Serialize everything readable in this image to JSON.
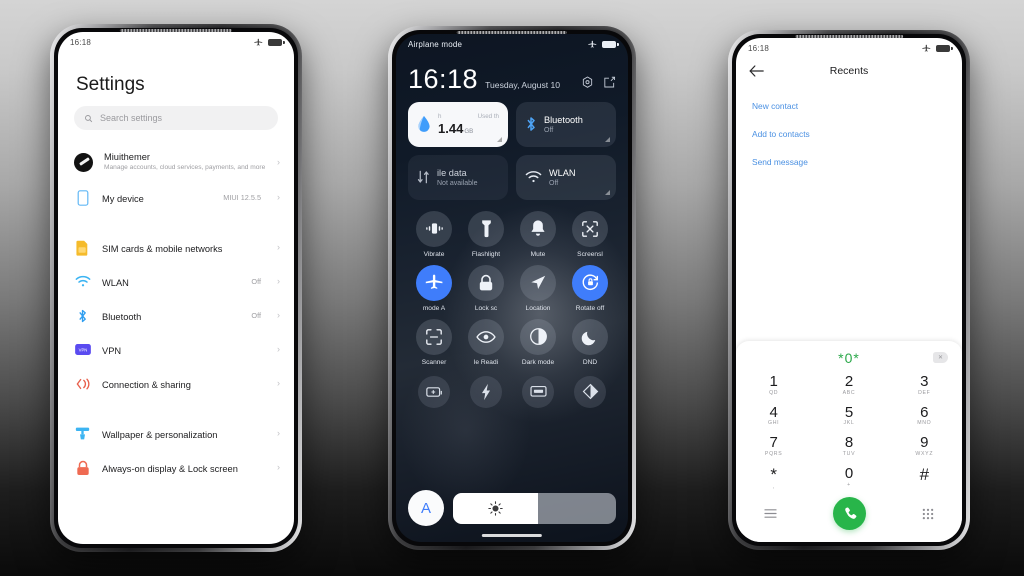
{
  "background": {
    "top_color": "#d4d4d4",
    "bottom_color": "#0a0a0a"
  },
  "phone_settings": {
    "status": {
      "time": "16:18",
      "airplane_icon": "airplane-icon",
      "battery_icon": "battery-icon"
    },
    "title": "Settings",
    "search": {
      "placeholder": "Search settings",
      "icon": "search-icon"
    },
    "account": {
      "name": "Miuithemer",
      "subtitle": "Manage accounts, cloud services, payments, and more",
      "avatar": "user-avatar"
    },
    "items": [
      {
        "label": "My device",
        "value": "MIUI 12.5.5",
        "icon": "phone-icon",
        "color": "#62b8f5",
        "gap_after": true
      },
      {
        "label": "SIM cards & mobile networks",
        "value": "",
        "icon": "sim-card-icon",
        "color": "#f5bb2b"
      },
      {
        "label": "WLAN",
        "value": "Off",
        "icon": "wifi-icon",
        "color": "#3cb4f2"
      },
      {
        "label": "Bluetooth",
        "value": "Off",
        "icon": "bluetooth-icon",
        "color": "#2f9ef0"
      },
      {
        "label": "VPN",
        "value": "",
        "icon": "vpn-icon",
        "color": "#5a4bf0"
      },
      {
        "label": "Connection & sharing",
        "value": "",
        "icon": "connection-sharing-icon",
        "color": "#e8604c",
        "gap_after": true
      },
      {
        "label": "Wallpaper & personalization",
        "value": "",
        "icon": "wallpaper-icon",
        "color": "#3cb4f2"
      },
      {
        "label": "Always-on display & Lock screen",
        "value": "",
        "icon": "lock-icon",
        "color": "#ef6a52"
      }
    ],
    "chevron": "›"
  },
  "phone_control_center": {
    "status": {
      "time": "",
      "label": "Airplane mode",
      "airplane_icon": "airplane-icon",
      "battery_icon": "battery-icon"
    },
    "clock": {
      "time": "16:18",
      "date": "Tuesday, August 10"
    },
    "actions": [
      {
        "name": "settings-gear-icon"
      },
      {
        "name": "edit-icon"
      }
    ],
    "big_tiles": [
      {
        "name": "data-usage-tile",
        "style": "white",
        "icon": "data-drop-icon",
        "head_left": "h",
        "head_right": "Used th",
        "value": "1.44",
        "unit": "GB"
      },
      {
        "name": "bluetooth-tile",
        "style": "dark",
        "icon": "bluetooth-icon",
        "title": "Bluetooth",
        "sub": "Off"
      },
      {
        "name": "mobile-data-tile",
        "style": "dim",
        "icon": "mobile-data-icon",
        "title": "ile data",
        "sub": "Not available"
      },
      {
        "name": "wlan-tile",
        "style": "dark",
        "icon": "wifi-icon",
        "title": "WLAN",
        "sub": "Off"
      }
    ],
    "toggles": [
      {
        "label": "Vibrate",
        "icon": "vibrate-icon",
        "on": false
      },
      {
        "label": "Flashlight",
        "icon": "flashlight-icon",
        "on": false
      },
      {
        "label": "Mute",
        "icon": "bell-icon",
        "on": false
      },
      {
        "label": "Screensl",
        "icon": "screenshot-icon",
        "on": false
      },
      {
        "label": "mode    A",
        "icon": "airplane-icon",
        "on": true
      },
      {
        "label": "Lock sc",
        "icon": "lock-icon",
        "on": false
      },
      {
        "label": "Location",
        "icon": "location-icon",
        "on": false
      },
      {
        "label": "Rotate off",
        "icon": "rotate-lock-icon",
        "on": true
      },
      {
        "label": "Scanner",
        "icon": "scan-icon",
        "on": false
      },
      {
        "label": "le    Readi",
        "icon": "eye-icon",
        "on": false
      },
      {
        "label": "Dark mode",
        "icon": "contrast-icon",
        "on": false
      },
      {
        "label": "DND",
        "icon": "moon-icon",
        "on": false
      }
    ],
    "mini_toggles": [
      {
        "icon": "battery-saver-icon"
      },
      {
        "icon": "lightning-icon"
      },
      {
        "icon": "cast-screen-icon"
      },
      {
        "icon": "theme-contrast-icon"
      }
    ],
    "brightness": {
      "auto_label": "A",
      "icon": "brightness-icon",
      "percent": 52
    }
  },
  "phone_dialer": {
    "status": {
      "time": "16:18",
      "airplane_icon": "airplane-icon",
      "battery_icon": "battery-icon"
    },
    "header": {
      "back_icon": "back-arrow-icon",
      "title": "Recents"
    },
    "links": [
      {
        "label": "New contact"
      },
      {
        "label": "Add to contacts"
      },
      {
        "label": "Send message"
      }
    ],
    "input": {
      "value": "*0*",
      "delete_icon": "backspace-icon"
    },
    "keys": [
      {
        "digit": "1",
        "letters": "QD"
      },
      {
        "digit": "2",
        "letters": "ABC"
      },
      {
        "digit": "3",
        "letters": "DEF"
      },
      {
        "digit": "4",
        "letters": "GHI"
      },
      {
        "digit": "5",
        "letters": "JKL"
      },
      {
        "digit": "6",
        "letters": "MNO"
      },
      {
        "digit": "7",
        "letters": "PQRS"
      },
      {
        "digit": "8",
        "letters": "TUV"
      },
      {
        "digit": "9",
        "letters": "WXYZ"
      },
      {
        "digit": "*",
        "letters": ","
      },
      {
        "digit": "0",
        "letters": "+"
      },
      {
        "digit": "#",
        "letters": ""
      }
    ],
    "bottom": {
      "menu_icon": "menu-icon",
      "call_icon": "call-icon",
      "keypad_icon": "keypad-icon",
      "call_color": "#28b54a"
    }
  }
}
